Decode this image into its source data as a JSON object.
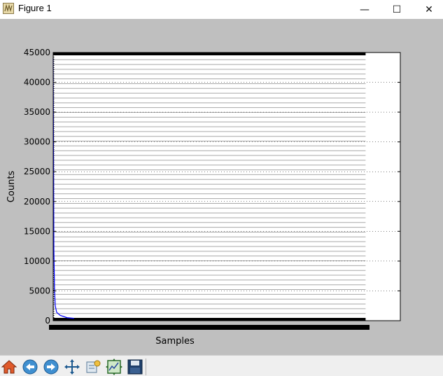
{
  "window": {
    "title": "Figure 1",
    "controls": {
      "minimize": "—",
      "maximize": "☐",
      "close": "✕"
    }
  },
  "toolbar": {
    "buttons": [
      {
        "name": "home",
        "icon": "home-icon"
      },
      {
        "name": "back",
        "icon": "back-arrow-icon"
      },
      {
        "name": "forward",
        "icon": "forward-arrow-icon"
      },
      {
        "name": "pan",
        "icon": "pan-arrows-icon"
      },
      {
        "name": "zoom",
        "icon": "zoom-rect-icon"
      },
      {
        "name": "configure-subplots",
        "icon": "subplots-icon"
      },
      {
        "name": "save",
        "icon": "floppy-disk-icon"
      }
    ]
  },
  "chart_data": {
    "type": "line",
    "title": "",
    "xlabel": "Samples",
    "ylabel": "Counts",
    "ylim": [
      0,
      45000
    ],
    "yticks": [
      "0",
      "5000",
      "10000",
      "15000",
      "20000",
      "25000",
      "30000",
      "35000",
      "40000",
      "45000"
    ],
    "xlim": [
      0,
      1
    ],
    "x_tick_labels_illegible": true,
    "grid": true,
    "grid_style": "dotted",
    "series": [
      {
        "color": "#0000ff",
        "x": [
          0,
          0.002,
          0.004,
          0.006,
          0.01,
          0.02,
          0.04,
          0.06
        ],
        "y": [
          44000,
          12000,
          5000,
          2500,
          1400,
          900,
          500,
          400
        ]
      }
    ],
    "hlines_count": 56,
    "hlines_color": "#a8a8a8",
    "hlines_extent": [
      0,
      0.8
    ],
    "colors": {
      "background": "#bfbfbf",
      "plot_background": "#ffffff",
      "line": "#0000ff"
    }
  }
}
